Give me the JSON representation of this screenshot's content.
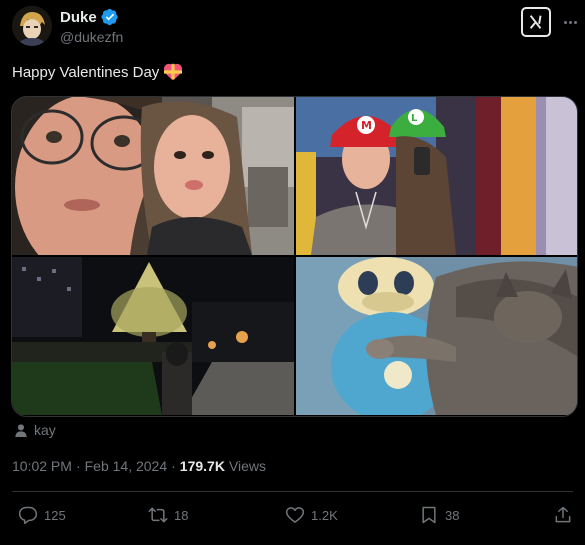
{
  "author": {
    "display_name": "Duke",
    "handle": "@dukezfn",
    "verified": true,
    "avatar_icon": "avatar-image"
  },
  "header": {
    "grok_icon": "grok-icon",
    "more_icon": "more-icon"
  },
  "tweet": {
    "text": "Happy Valentines Day",
    "emoji": "heart-with-ribbon"
  },
  "media": [
    {
      "description_icon": "selfie-photo"
    },
    {
      "description_icon": "mario-hats-photo"
    },
    {
      "description_icon": "christmas-tree-photo"
    },
    {
      "description_icon": "cat-plush-photo"
    }
  ],
  "tagged_user": "kay",
  "meta": {
    "time": "10:02 PM",
    "separator": "·",
    "date": "Feb 14, 2024",
    "views_count": "179.7K",
    "views_label": "Views"
  },
  "actions": {
    "replies": "125",
    "retweets": "18",
    "likes": "1.2K",
    "bookmarks": "38"
  },
  "colors": {
    "background": "#000000",
    "text": "#e7e9ea",
    "secondary": "#71767b",
    "verified": "#1d9bf0",
    "border": "#2f3336"
  }
}
